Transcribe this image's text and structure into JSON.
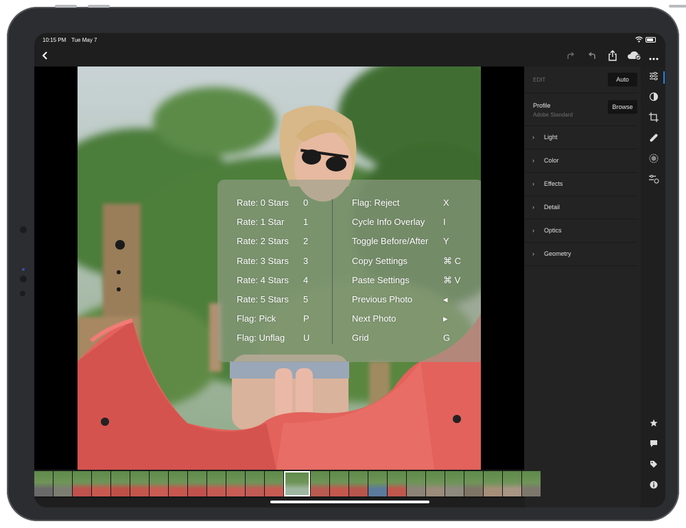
{
  "status_bar": {
    "time": "10:15 PM",
    "date": "Tue May 7"
  },
  "toolbar": {
    "back_icon": "chevron-left-icon",
    "redo_icon": "redo-icon",
    "undo_icon": "undo-icon",
    "share_icon": "share-icon",
    "cloud_icon": "cloud-sync-icon",
    "more_icon": "more-icon"
  },
  "shortcuts_overlay": {
    "left": [
      {
        "label": "Rate: 0 Stars",
        "key": "0"
      },
      {
        "label": "Rate: 1 Star",
        "key": "1"
      },
      {
        "label": "Rate: 2 Stars",
        "key": "2"
      },
      {
        "label": "Rate: 3 Stars",
        "key": "3"
      },
      {
        "label": "Rate: 4 Stars",
        "key": "4"
      },
      {
        "label": "Rate: 5 Stars",
        "key": "5"
      },
      {
        "label": "Flag: Pick",
        "key": "P"
      },
      {
        "label": "Flag: Unflag",
        "key": "U"
      }
    ],
    "right": [
      {
        "label": "Flag: Reject",
        "key": "X"
      },
      {
        "label": "Cycle Info Overlay",
        "key": "I"
      },
      {
        "label": "Toggle Before/After",
        "key": "Y"
      },
      {
        "label": "Copy Settings",
        "key": "⌘ C"
      },
      {
        "label": "Paste Settings",
        "key": "⌘ V"
      },
      {
        "label": "Previous Photo",
        "key": "◂"
      },
      {
        "label": "Next Photo",
        "key": "▸"
      },
      {
        "label": "Grid",
        "key": "G"
      }
    ]
  },
  "edit_panel": {
    "header_label": "EDIT",
    "auto_button": "Auto",
    "profile_label": "Profile",
    "profile_value": "Adobe Standard",
    "browse_button": "Browse",
    "sections": [
      {
        "label": "Light"
      },
      {
        "label": "Color"
      },
      {
        "label": "Effects"
      },
      {
        "label": "Detail"
      },
      {
        "label": "Optics"
      },
      {
        "label": "Geometry"
      }
    ],
    "reset_icon": "reset-icon"
  },
  "toolstrip": {
    "top_tools": [
      "edit-sliders-icon",
      "selective-icon",
      "crop-icon",
      "healing-icon",
      "vignette-icon",
      "presets-icon"
    ],
    "bottom_tools": [
      "star-icon",
      "comment-icon",
      "tag-icon",
      "info-icon"
    ]
  },
  "filmstrip": {
    "selected_index": 13,
    "thumb_colors": [
      "#6a6a6a",
      "#7b7d72",
      "#c0524d",
      "#c75a50",
      "#be5047",
      "#c4564d",
      "#c85c52",
      "#c5574f",
      "#c0514c",
      "#c45b52",
      "#c75d55",
      "#bf5c55",
      "#c85b52",
      "#9fb6a0",
      "#b95b50",
      "#c4584f",
      "#b6564d",
      "#5b7a9c",
      "#c0574e",
      "#8c8377",
      "#9a8b7a",
      "#8e8a7e",
      "#7f7566",
      "#a68f78",
      "#a89583",
      "#7d776c"
    ]
  },
  "colors": {
    "device": "#2c2d30",
    "panel": "#232323",
    "accent": "#1e88e5",
    "slide": "#e3625c"
  }
}
